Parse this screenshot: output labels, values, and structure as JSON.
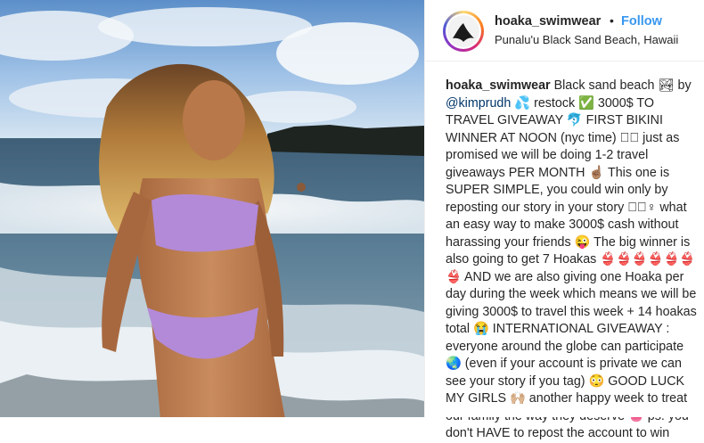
{
  "post": {
    "username": "hoaka_swimwear",
    "separator": "•",
    "follow_label": "Follow",
    "location": "Punalu'u Black Sand Beach, Hawaii"
  },
  "caption": {
    "username": "hoaka_swimwear",
    "part1": " Black sand beach 🏞 by ",
    "mention": "@kimprudh",
    "part2": " 💦 restock ✅ 3000$ TO TRAVEL GIVEAWAY 🐬 FIRST BIKINI WINNER AT NOON (nyc time) ☐🏽 just as promised we will be doing 1-2 travel giveaways PER MONTH ☝🏽 This one is SUPER SIMPLE, you could win only by reposting our story in your story ☐🏽♀ what an easy way to make 3000$ cash without harassing your friends 😜 The big winner is also going to get 7 Hoakas 👙👙👙👙👙👙👙 AND we are also giving one Hoaka per day during the week which means we will be giving 3000$ to travel this week + 14 hoakas total 😭 INTERNATIONAL GIVEAWAY : everyone around the globe can participate 🌏 (even if your account is private we can see your story if you tag) 😳 GOOD LUCK MY GIRLS 🙌🏼 another happy week to treat our family the way they deserve 👅 ps: you don't HAVE to repost the account to win"
  },
  "colors": {
    "link": "#3897f0",
    "mention": "#003569",
    "text": "#262626"
  },
  "icons": [
    "avatar-logo-icon"
  ]
}
